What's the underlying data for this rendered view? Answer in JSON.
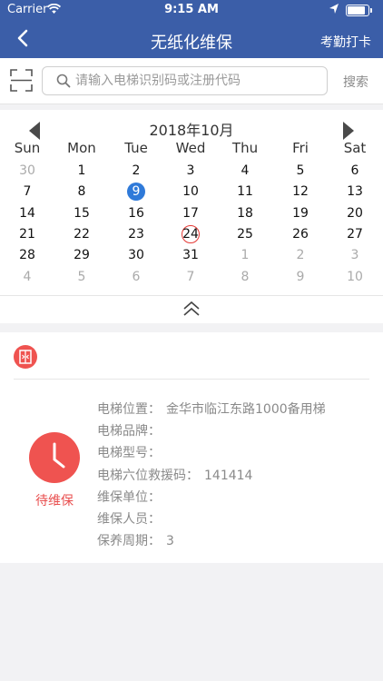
{
  "status_bar": {
    "carrier": "Carrier",
    "time": "9:15 AM",
    "battery_level": 0.85
  },
  "nav": {
    "title": "无纸化维保",
    "right_label": "考勤打卡"
  },
  "search": {
    "placeholder": "请输入电梯识别码或注册代码",
    "value": "",
    "button": "搜索"
  },
  "calendar": {
    "title": "2018年10月",
    "weekdays": [
      "Sun",
      "Mon",
      "Tue",
      "Wed",
      "Thu",
      "Fri",
      "Sat"
    ],
    "weeks": [
      [
        {
          "d": "30",
          "m": true
        },
        {
          "d": "1"
        },
        {
          "d": "2"
        },
        {
          "d": "3"
        },
        {
          "d": "4"
        },
        {
          "d": "5"
        },
        {
          "d": "6"
        }
      ],
      [
        {
          "d": "7"
        },
        {
          "d": "8"
        },
        {
          "d": "9",
          "today": true
        },
        {
          "d": "10"
        },
        {
          "d": "11"
        },
        {
          "d": "12"
        },
        {
          "d": "13"
        }
      ],
      [
        {
          "d": "14"
        },
        {
          "d": "15"
        },
        {
          "d": "16"
        },
        {
          "d": "17"
        },
        {
          "d": "18"
        },
        {
          "d": "19"
        },
        {
          "d": "20"
        }
      ],
      [
        {
          "d": "21"
        },
        {
          "d": "22"
        },
        {
          "d": "23"
        },
        {
          "d": "24",
          "marked": true
        },
        {
          "d": "25"
        },
        {
          "d": "26"
        },
        {
          "d": "27"
        }
      ],
      [
        {
          "d": "28"
        },
        {
          "d": "29"
        },
        {
          "d": "30"
        },
        {
          "d": "31"
        },
        {
          "d": "1",
          "m": true
        },
        {
          "d": "2",
          "m": true
        },
        {
          "d": "3",
          "m": true
        }
      ],
      [
        {
          "d": "4",
          "m": true
        },
        {
          "d": "5",
          "m": true
        },
        {
          "d": "6",
          "m": true
        },
        {
          "d": "7",
          "m": true
        },
        {
          "d": "8",
          "m": true
        },
        {
          "d": "9",
          "m": true
        },
        {
          "d": "10",
          "m": true
        }
      ]
    ]
  },
  "card": {
    "status": "待维保",
    "fields": [
      {
        "label": "电梯位置：",
        "value": "金华市临江东路1000备用梯"
      },
      {
        "label": "电梯品牌：",
        "value": ""
      },
      {
        "label": "电梯型号：",
        "value": ""
      },
      {
        "label": "电梯六位救援码：",
        "value": "141414"
      },
      {
        "label": "维保单位：",
        "value": ""
      },
      {
        "label": "维保人员：",
        "value": ""
      },
      {
        "label": "保养周期：",
        "value": "3"
      }
    ]
  },
  "colors": {
    "nav_bg": "#3b5ea8",
    "today": "#2f7ad9",
    "marked": "#e53935",
    "pending": "#ef5350",
    "pending_text": "#e84e4e"
  }
}
